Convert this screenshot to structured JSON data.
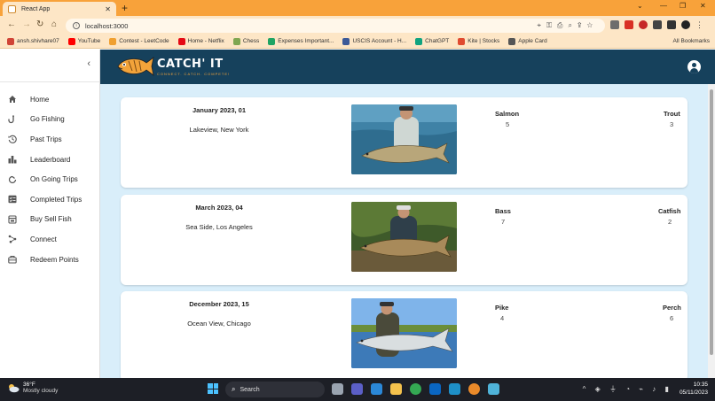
{
  "browser": {
    "tab_title": "React App",
    "url": "localhost:3000",
    "bookmarks": [
      {
        "label": "ansh.shivhare07",
        "color": "#d04437"
      },
      {
        "label": "YouTube",
        "color": "#ff0000"
      },
      {
        "label": "Contest - LeetCode",
        "color": "#f0a030"
      },
      {
        "label": "Home - Netflix",
        "color": "#e50914"
      },
      {
        "label": "Chess",
        "color": "#7fa650"
      },
      {
        "label": "Expenses Important...",
        "color": "#1fa463"
      },
      {
        "label": "USCIS Account - H...",
        "color": "#3b5998"
      },
      {
        "label": "ChatGPT",
        "color": "#10a37f"
      },
      {
        "label": "Kite | Stocks",
        "color": "#e04a2f"
      },
      {
        "label": "Apple Card",
        "color": "#555555"
      }
    ],
    "all_bookmarks": "All Bookmarks"
  },
  "app": {
    "brand": "CATCH' IT",
    "tagline": "CONNECT. CATCH. COMPETE!",
    "nav": [
      {
        "label": "Home",
        "icon": "home-icon"
      },
      {
        "label": "Go Fishing",
        "icon": "fishing-hook-icon"
      },
      {
        "label": "Past Trips",
        "icon": "history-icon"
      },
      {
        "label": "Leaderboard",
        "icon": "leaderboard-icon"
      },
      {
        "label": "On Going Trips",
        "icon": "ongoing-icon"
      },
      {
        "label": "Completed Trips",
        "icon": "checklist-icon"
      },
      {
        "label": "Buy Sell Fish",
        "icon": "store-icon"
      },
      {
        "label": "Connect",
        "icon": "connect-icon"
      },
      {
        "label": "Redeem Points",
        "icon": "redeem-icon"
      }
    ],
    "trips": [
      {
        "date": "January 2023, 01",
        "location": "Lakeview, New York",
        "catches": [
          {
            "fish": "Salmon",
            "count": "5"
          },
          {
            "fish": "Trout",
            "count": "3"
          }
        ]
      },
      {
        "date": "March 2023, 04",
        "location": "Sea Side, Los Angeles",
        "catches": [
          {
            "fish": "Bass",
            "count": "7"
          },
          {
            "fish": "Catfish",
            "count": "2"
          }
        ]
      },
      {
        "date": "December 2023, 15",
        "location": "Ocean View, Chicago",
        "catches": [
          {
            "fish": "Pike",
            "count": "4"
          },
          {
            "fish": "Perch",
            "count": "6"
          }
        ]
      }
    ]
  },
  "taskbar": {
    "temperature": "36°F",
    "condition": "Mostly cloudy",
    "search_label": "Search",
    "time": "10:35",
    "date": "05/11/2023"
  },
  "colors": {
    "appbar": "#16415c",
    "content_bg": "#d9eefa",
    "browser_accent": "#f8a23a"
  }
}
